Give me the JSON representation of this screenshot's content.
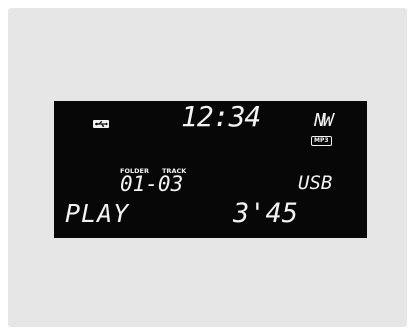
{
  "display": {
    "clock": "12:34",
    "mode": "NW",
    "format_badge": "MP3",
    "folder_label": "FOLDER",
    "track_label": "TRACK",
    "folder_track": "01-03",
    "source": "USB",
    "status": "PLAY",
    "elapsed": "3'45"
  },
  "icons": {
    "usb": "usb-icon"
  },
  "colors": {
    "background": "#e6e6e6",
    "screen": "#070707",
    "segment": "#f2f2f2"
  }
}
